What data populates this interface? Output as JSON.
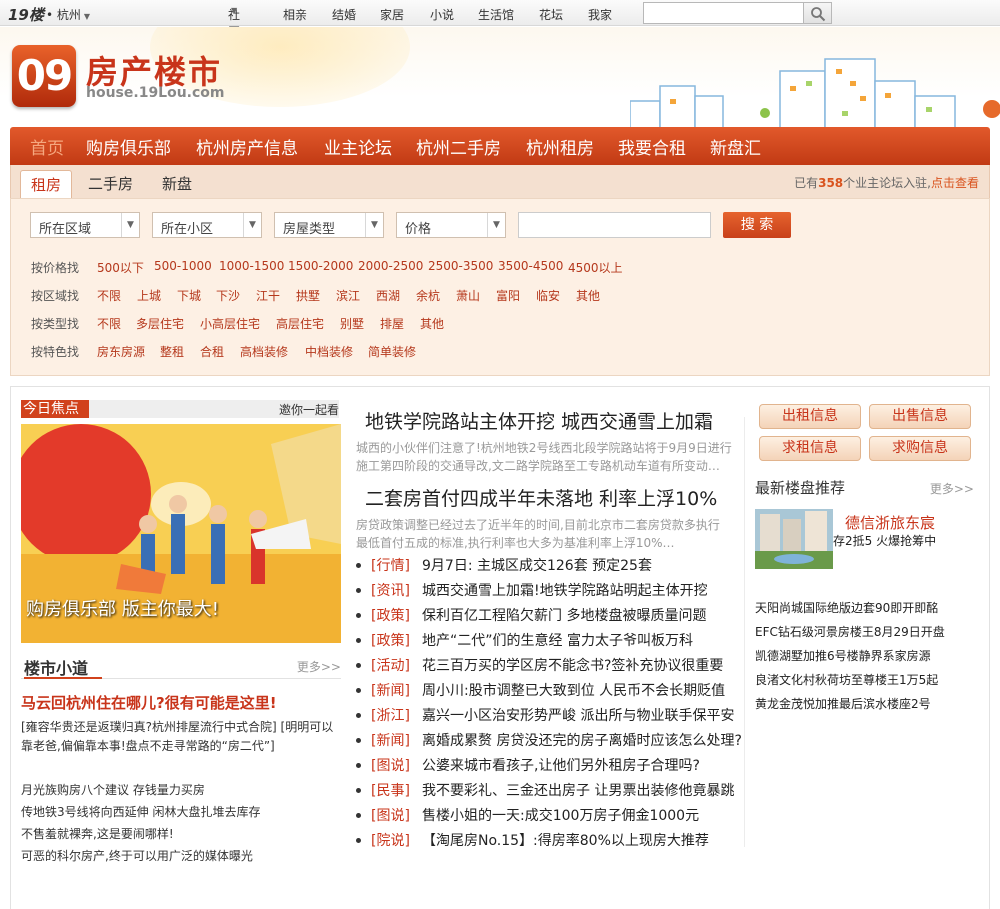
{
  "topbar": {
    "site_logo": "19楼",
    "city": "• 杭州",
    "nav": [
      "社区",
      "相亲",
      "结婚",
      "家居",
      "小说",
      "生活馆",
      "花坛",
      "我家"
    ],
    "search_placeholder": ""
  },
  "header": {
    "logo_number": "09",
    "title": "房产楼市",
    "url": "house.19Lou.com"
  },
  "mainnav": [
    "首页",
    "购房俱乐部",
    "杭州房产信息",
    "业主论坛",
    "杭州二手房",
    "杭州租房",
    "我要合租",
    "新盘汇"
  ],
  "subbar": {
    "tabs": [
      "租房",
      "二手房",
      "新盘"
    ],
    "right_prefix": "已有",
    "right_count": "358",
    "right_mid": "个业主论坛入驻,",
    "right_link": "点击查看"
  },
  "filter": {
    "selects": [
      "所在区域",
      "所在小区",
      "房屋类型",
      "价格"
    ],
    "keyword_value": "",
    "search_label": "搜 索",
    "rows": [
      {
        "label": "按价格找",
        "options": [
          "500以下",
          "500-1000",
          "1000-1500",
          "1500-2000",
          "2000-2500",
          "2500-3500",
          "3500-4500",
          "4500以上"
        ]
      },
      {
        "label": "按区域找",
        "options": [
          "不限",
          "上城",
          "下城",
          "下沙",
          "江干",
          "拱墅",
          "滨江",
          "西湖",
          "余杭",
          "萧山",
          "富阳",
          "临安",
          "其他"
        ]
      },
      {
        "label": "按类型找",
        "options": [
          "不限",
          "多层住宅",
          "小高层住宅",
          "高层住宅",
          "别墅",
          "排屋",
          "其他"
        ]
      },
      {
        "label": "按特色找",
        "options": [
          "房东房源",
          "整租",
          "合租",
          "高档装修",
          "中档装修",
          "简单装修"
        ]
      }
    ]
  },
  "focus": {
    "tag": "今日焦点",
    "link": "邀你一起看",
    "caption": "购房俱乐部 版主你最大!"
  },
  "louguide": {
    "title": "楼市小道",
    "more": "更多>>",
    "headline": "马云回杭州住在哪儿?很有可能是这里!",
    "sub_lines": [
      "[雍容华贵还是返璞归真?杭州排屋流行中式合院] [明明可以",
      "靠老爸,偏偏靠本事!盘点不走寻常路的“房二代”]"
    ],
    "list": [
      "月光族购房八个建议 存钱量力买房",
      "传地铁3号线将向西延伸 闲林大盘扎堆去库存",
      "不售羞就裸奔,这是要闹哪样!",
      "可恶的科尔房产,终于可以用广泛的媒体曝光"
    ]
  },
  "middle": {
    "headline1": "地铁学院路站主体开挖 城西交通雪上加霜",
    "summary1": [
      "城西的小伙伴们注意了!杭州地铁2号线西北段学院路站将于9月9日进行",
      "施工第四阶段的交通导改,文二路学院路至工专路机动车道有所变动…"
    ],
    "headline2": "二套房首付四成半年未落地 利率上浮10%",
    "summary2": [
      "房贷政策调整已经过去了近半年的时间,目前北京市二套房贷款多执行",
      "最低首付五成的标准,执行利率也大多为基准利率上浮10%…"
    ],
    "news": [
      {
        "cat": "[行情]",
        "text": "9月7日: 主城区成交126套 预定25套"
      },
      {
        "cat": "[资讯]",
        "text": "城西交通雪上加霜!地铁学院路站明起主体开挖"
      },
      {
        "cat": "[政策]",
        "text": "保利百亿工程陷欠薪门 多地楼盘被曝质量问题"
      },
      {
        "cat": "[政策]",
        "text": "地产“二代”们的生意经 富力太子爷叫板万科"
      },
      {
        "cat": "[活动]",
        "text": "花三百万买的学区房不能念书?签补充协议很重要"
      },
      {
        "cat": "[新闻]",
        "text": "周小川:股市调整已大致到位 人民币不会长期贬值"
      },
      {
        "cat": "[浙江]",
        "text": "嘉兴一小区治安形势严峻 派出所与物业联手保平安"
      },
      {
        "cat": "[新闻]",
        "text": "离婚成累赘 房贷没还完的房子离婚时应该怎么处理?"
      },
      {
        "cat": "[图说]",
        "text": "公婆来城市看孩子,让他们另外租房子合理吗?"
      },
      {
        "cat": "[民事]",
        "text": "我不要彩礼、三金还出房子 让男票出装修他竟暴跳"
      },
      {
        "cat": "[图说]",
        "text": "售楼小姐的一天:成交100万房子佣金1000元"
      },
      {
        "cat": "[院说]",
        "text": "【淘尾房No.15】:得房率80%以上现房大推荐"
      }
    ]
  },
  "right": {
    "buttons": [
      "出租信息",
      "出售信息",
      "求租信息",
      "求购信息"
    ],
    "section_title": "最新楼盘推荐",
    "more": "更多>>",
    "featured_name": "德信浙旅东宸",
    "featured_desc": "存2抵5 火爆抢筹中",
    "list": [
      "天阳尚城国际绝版边套90即开即酩",
      "EFC钻石级河景房楼王8月29日开盘",
      "凯德湖墅加推6号楼静界系家房源",
      "良渚文化村秋荷坊至尊楼王1万5起",
      "黄龙金茂悦加推最后滨水楼座2号"
    ]
  }
}
